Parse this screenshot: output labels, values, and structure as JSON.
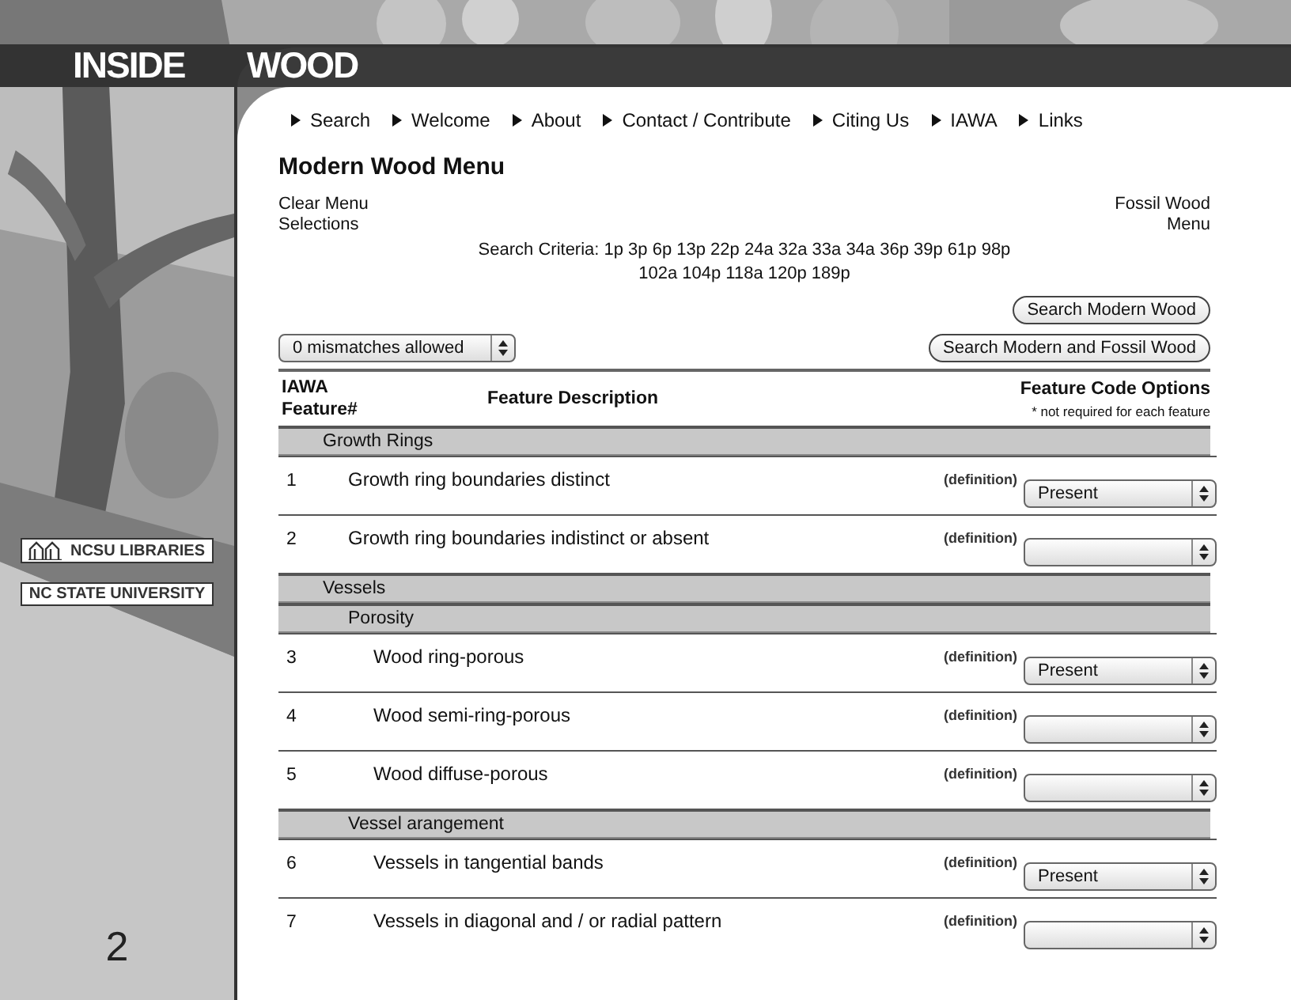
{
  "banner": {
    "title_words": [
      "INSIDE",
      "WOOD"
    ]
  },
  "sidebar": {
    "logos": [
      {
        "kind": "libraries",
        "text": "NCSU LIBRARIES"
      },
      {
        "kind": "university",
        "text": "NC STATE UNIVERSITY"
      }
    ],
    "page_number": "2"
  },
  "nav": [
    "Search",
    "Welcome",
    "About",
    "Contact / Contribute",
    "Citing Us",
    "IAWA",
    "Links"
  ],
  "heading": "Modern Wood Menu",
  "clear_link": "Clear Menu Selections",
  "fossil_link": "Fossil Wood Menu",
  "search_criteria": [
    "Search Criteria: 1p 3p 6p 13p 22p 24a 32a 33a 34a 36p 39p 61p 98p",
    "102a 104p 118a 120p 189p"
  ],
  "mismatch_select": "0 mismatches allowed",
  "buttons": [
    "Search Modern Wood",
    "Search Modern and Fossil Wood"
  ],
  "table": {
    "columns": [
      "IAWA Feature#",
      "Feature Description",
      "Feature Code Options"
    ],
    "note": "* not required for each feature",
    "sections": [
      {
        "title": "Growth Rings",
        "features": [
          {
            "number": "1",
            "description": "Growth ring boundaries distinct",
            "link": "(definition)",
            "value": "Present"
          },
          {
            "number": "2",
            "description": "Growth ring boundaries indistinct or absent",
            "link": "(definition)"
          }
        ]
      },
      {
        "title": "Vessels",
        "children": [
          {
            "title": "Porosity",
            "features": [
              {
                "number": "3",
                "description": "Wood ring-porous",
                "link": "(definition)",
                "value": "Present"
              },
              {
                "number": "4",
                "description": "Wood semi-ring-porous",
                "link": "(definition)"
              },
              {
                "number": "5",
                "description": "Wood diffuse-porous",
                "link": "(definition)"
              }
            ]
          },
          {
            "title": "Vessel arangement",
            "features": [
              {
                "number": "6",
                "description": "Vessels in tangential bands",
                "link": "(definition)",
                "value": "Present"
              },
              {
                "number": "7",
                "description": "Vessels in diagonal and / or radial pattern",
                "link": "(definition)"
              }
            ]
          }
        ]
      }
    ]
  }
}
